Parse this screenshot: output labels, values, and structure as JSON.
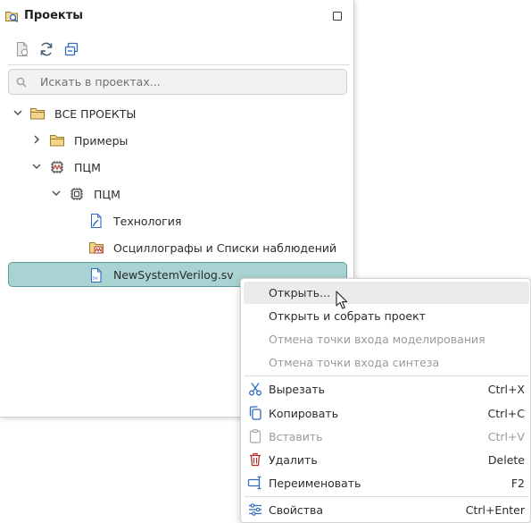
{
  "panel": {
    "title": "Проекты",
    "title_icon": "project-search-icon",
    "toolbar": [
      {
        "name": "new-file-icon"
      },
      {
        "name": "refresh-icon"
      },
      {
        "name": "collapse-all-icon"
      }
    ],
    "search": {
      "placeholder": "Искать в проектах...",
      "value": ""
    }
  },
  "tree": [
    {
      "label": "ВСЕ ПРОЕКТЫ",
      "icon": "folder-icon",
      "expanded": true
    },
    {
      "label": "Примеры",
      "icon": "folder-icon",
      "expanded": false
    },
    {
      "label": "ПЦМ",
      "icon": "chip-waveform-icon",
      "expanded": true
    },
    {
      "label": "ПЦМ",
      "icon": "chip-icon",
      "expanded": true
    },
    {
      "label": "Технология",
      "icon": "technology-file-icon"
    },
    {
      "label": "Осциллографы и Списки наблюдений",
      "icon": "waveform-folder-icon"
    },
    {
      "label": "NewSystemVerilog.sv",
      "icon": "sv-file-icon",
      "selected": true
    }
  ],
  "context_menu": {
    "items": [
      {
        "label": "Открыть...",
        "shortcut": "",
        "icon": "",
        "enabled": true,
        "hover": true
      },
      {
        "label": "Открыть и собрать проект",
        "shortcut": "",
        "icon": "",
        "enabled": true
      },
      {
        "label": "Отмена точки входа моделирования",
        "shortcut": "",
        "icon": "",
        "enabled": false
      },
      {
        "label": "Отмена точки входа синтеза",
        "shortcut": "",
        "icon": "",
        "enabled": false
      },
      {
        "label": "Вырезать",
        "shortcut": "Ctrl+X",
        "icon": "scissors-icon",
        "enabled": true
      },
      {
        "label": "Копировать",
        "shortcut": "Ctrl+C",
        "icon": "copy-icon",
        "enabled": true
      },
      {
        "label": "Вставить",
        "shortcut": "Ctrl+V",
        "icon": "paste-icon",
        "enabled": false
      },
      {
        "label": "Удалить",
        "shortcut": "Delete",
        "icon": "trash-icon",
        "enabled": true
      },
      {
        "label": "Переименовать",
        "shortcut": "F2",
        "icon": "rename-icon",
        "enabled": true
      },
      {
        "label": "Свойства",
        "shortcut": "Ctrl+Enter",
        "icon": "properties-icon",
        "enabled": true
      }
    ]
  },
  "colors": {
    "selection_bg": "#a9d2d2",
    "selection_border": "#5f9e9e",
    "accent_blue": "#2f6bc0",
    "delete_red": "#b52f2f",
    "folder": "#e8c56a"
  }
}
